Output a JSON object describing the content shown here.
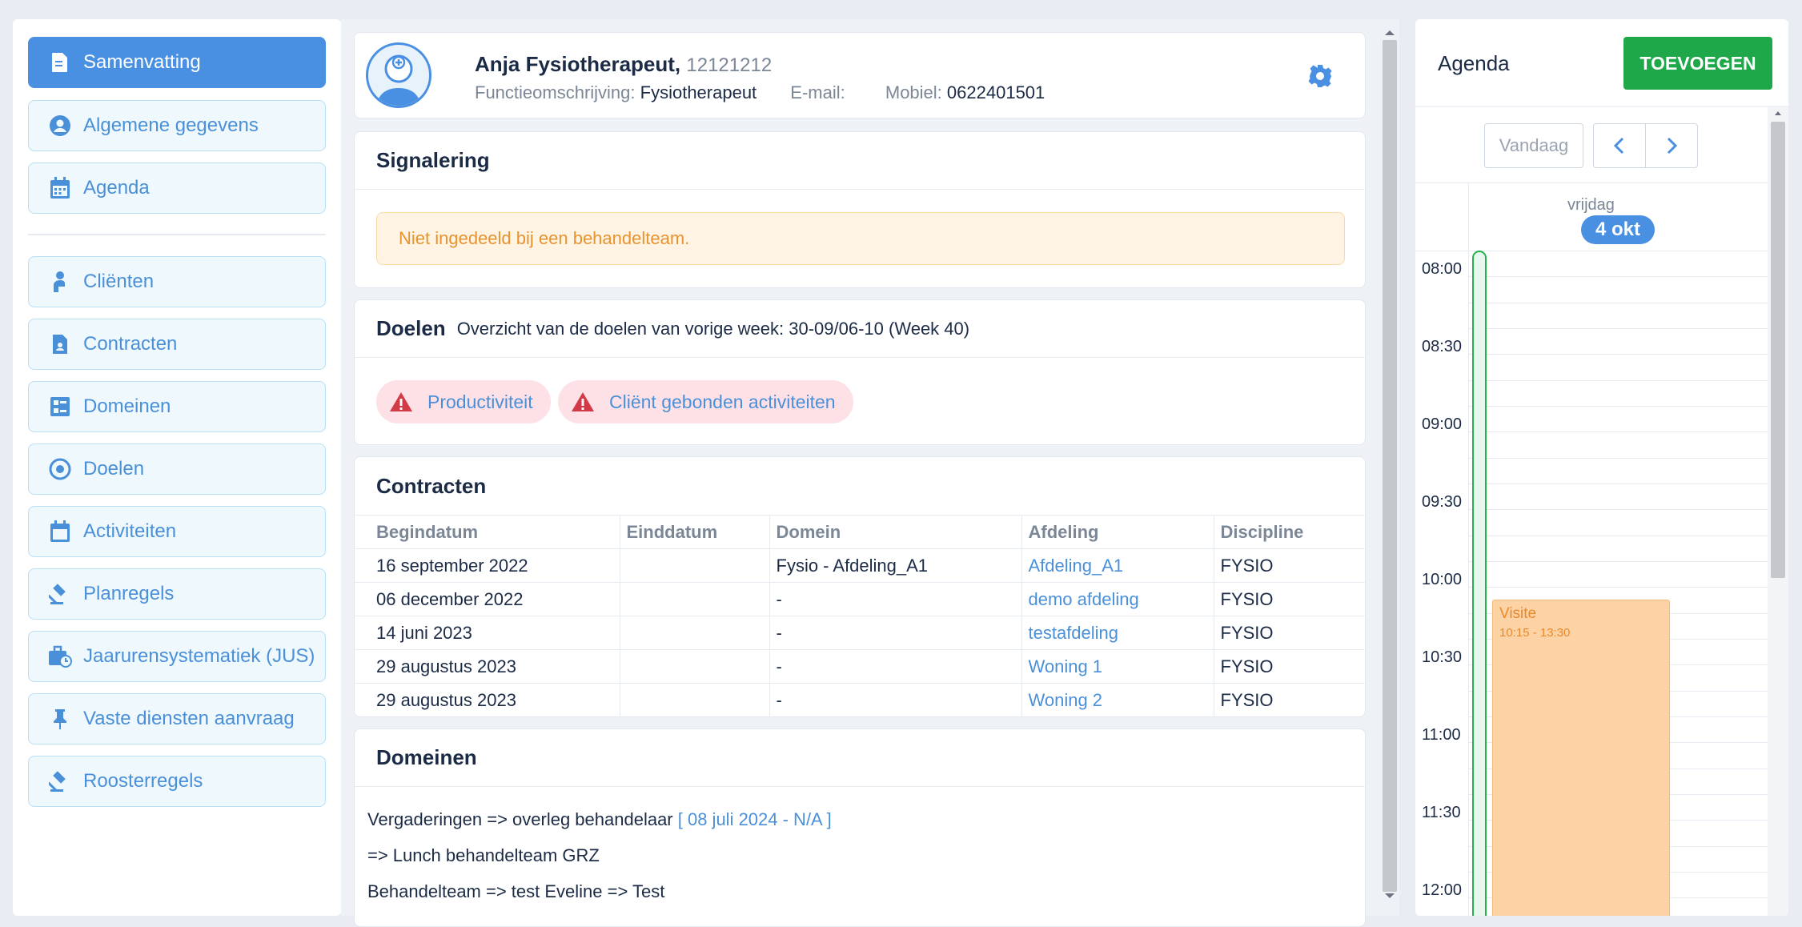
{
  "sidebar": {
    "items": [
      {
        "label": "Samenvatting",
        "icon": "document-icon",
        "active": true
      },
      {
        "label": "Algemene gegevens",
        "icon": "user-circle-icon"
      },
      {
        "label": "Agenda",
        "icon": "calendar-icon"
      },
      {
        "label": "Cliënten",
        "icon": "client-icon"
      },
      {
        "label": "Contracten",
        "icon": "contract-icon"
      },
      {
        "label": "Domeinen",
        "icon": "domains-icon"
      },
      {
        "label": "Doelen",
        "icon": "target-icon"
      },
      {
        "label": "Activiteiten",
        "icon": "calendar-blank-icon"
      },
      {
        "label": "Planregels",
        "icon": "gavel-icon"
      },
      {
        "label": "Jaarurensystematiek (JUS)",
        "icon": "briefcase-clock-icon"
      },
      {
        "label": "Vaste diensten aanvraag",
        "icon": "pin-icon"
      },
      {
        "label": "Roosterregels",
        "icon": "gavel-icon"
      }
    ]
  },
  "profile": {
    "name": "Anja Fysiotherapeut,",
    "id": "12121212",
    "function_label": "Functieomschrijving:",
    "function_value": "Fysiotherapeut",
    "email_label": "E-mail:",
    "mobile_label": "Mobiel:",
    "mobile_value": "0622401501"
  },
  "signalering": {
    "title": "Signalering",
    "alert": "Niet ingedeeld bij een behandelteam."
  },
  "doelen": {
    "title": "Doelen",
    "subtitle": "Overzicht van de doelen van vorige week: 30-09/06-10 (Week 40)",
    "badges": [
      "Productiviteit",
      "Cliënt gebonden activiteiten"
    ]
  },
  "contracten": {
    "title": "Contracten",
    "columns": [
      "Begindatum",
      "Einddatum",
      "Domein",
      "Afdeling",
      "Discipline"
    ],
    "rows": [
      [
        "16 september 2022",
        "",
        "Fysio - Afdeling_A1",
        "Afdeling_A1",
        "FYSIO"
      ],
      [
        "06 december 2022",
        "",
        "-",
        "demo afdeling",
        "FYSIO"
      ],
      [
        "14 juni 2023",
        "",
        "-",
        "testafdeling",
        "FYSIO"
      ],
      [
        "29 augustus 2023",
        "",
        "-",
        "Woning 1",
        "FYSIO"
      ],
      [
        "29 augustus 2023",
        "",
        "-",
        "Woning 2",
        "FYSIO"
      ]
    ]
  },
  "domeinen": {
    "title": "Domeinen",
    "lines": [
      {
        "text": "Vergaderingen => overleg behandelaar ",
        "link": "[ 08 juli 2024 - N/A ]"
      },
      {
        "text": "=> Lunch behandelteam GRZ",
        "link": ""
      },
      {
        "text": "Behandelteam => test Eveline => Test",
        "link": ""
      }
    ]
  },
  "agenda": {
    "title": "Agenda",
    "add_label": "TOEVOEGEN",
    "today_label": "Vandaag",
    "day_name": "vrijdag",
    "day_date": "4 okt",
    "times": [
      "08:00",
      "08:30",
      "09:00",
      "09:30",
      "10:00",
      "10:30",
      "11:00",
      "11:30",
      "12:00"
    ],
    "event": {
      "title": "Visite",
      "time": "10:15 - 13:30"
    }
  },
  "colors": {
    "accent": "#4a90e2",
    "success": "#1fa84a",
    "warning_bg": "#fff3e3",
    "event_bg": "#fdd3a6"
  }
}
